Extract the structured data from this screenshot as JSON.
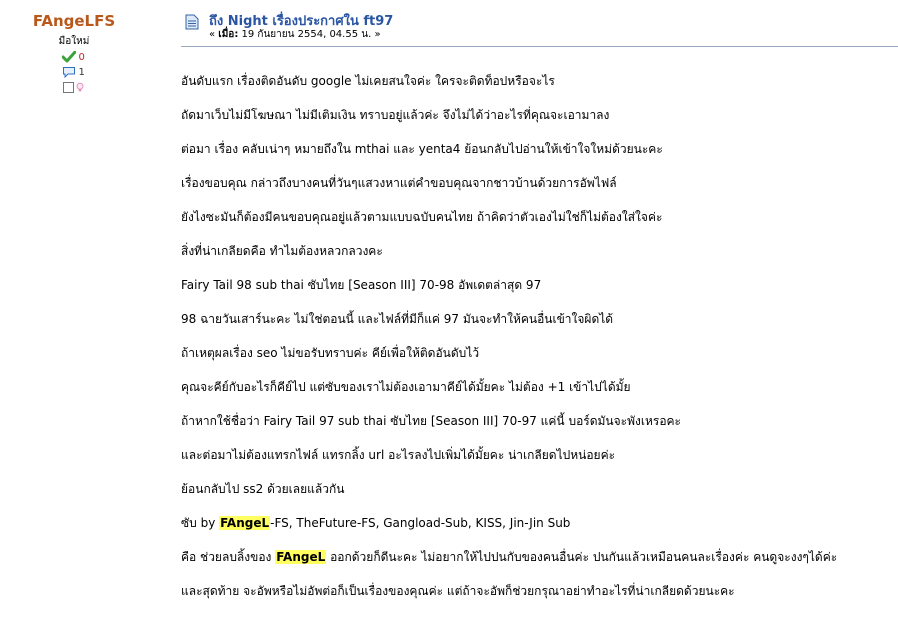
{
  "poster": {
    "name": "FAngeLFS",
    "rank": "มือใหม่",
    "karma_good": "0",
    "karma_comments": "1"
  },
  "post": {
    "subject": "ถึง Night เรื่องประกาศใน ft97",
    "meta_prefix": "« ",
    "meta_label": "เมื่อ:",
    "meta_date": " 19 กันยายน 2554, 04.55 น. »",
    "lines": [
      "อันดับแรก เรื่องติดอันดับ google ไม่เคยสนใจค่ะ ใครจะติดท็อปหรือจะไร",
      "ถัดมาเว็บไม่มีโฆษณา ไม่มีเติมเงิน ทราบอยู่แล้วค่ะ จึงไม่ได้ว่าอะไรที่คุณจะเอามาลง",
      "ต่อมา เรื่อง คลับเน่าๆ หมายถึงใน mthai และ yenta4 ย้อนกลับไปอ่านให้เข้าใจใหม่ด้วยนะคะ",
      "เรื่องขอบคุณ กล่าวถึงบางคนที่วันๆแสวงหาแต่คำขอบคุณจากชาวบ้านด้วยการอัพไฟล์",
      "ยังไงซะมันก็ต้องมีคนขอบคุณอยู่แล้วตามแบบฉบับคนไทย ถ้าคิดว่าตัวเองไม่ใช่ก็ไม่ต้องใส่ใจค่ะ",
      "สิ่งที่น่าเกลียดคือ ทำไมต้องหลวกลวงคะ",
      "Fairy Tail 98 sub thai ซับไทย [Season III] 70-98 อัพเดตล่าสุด 97",
      "98 ฉายวันเสาร์นะคะ ไม่ใช่ตอนนี้ และไฟล์ที่มีก็แค่ 97 มันจะทำให้คนอื่นเข้าใจผิดได้",
      "ถ้าเหตุผลเรื่อง seo ไม่ขอรับทราบค่ะ คีย์เพื่อให้ติดอันดับไว้",
      "คุณจะคีย์กับอะไรก็คีย์ไป แต่ซับของเราไม่ต้องเอามาคีย์ได้มั้ยคะ ไม่ต้อง +1 เข้าไปได้มั้ย",
      "ถ้าหากใช้ชื่อว่า Fairy Tail 97 sub thai ซับไทย [Season III] 70-97 แค่นี้ บอร์ดมันจะพังเหรอคะ",
      "และต่อมาไม่ต้องแทรกไฟล์ แทรกลิ้ง url อะไรลงไปเพิ่มได้มั้ยคะ น่าเกลียดไปหน่อยค่ะ",
      "ย้อนกลับไป ss2 ด้วยเลยแล้วกัน"
    ],
    "sub_line": {
      "prefix": "ซับ by ",
      "highlight": "FAngeL",
      "suffix": "-FS, TheFuture-FS, Gangload-Sub, KISS, Jin-Jin Sub"
    },
    "remove_line": {
      "prefix": "คือ ช่วยลบลิ้งของ ",
      "highlight": "FAngeL",
      "suffix": " ออกด้วยก็ดีนะคะ ไม่อยากให้ไปปนกับของคนอื่นค่ะ ปนกันแล้วเหมือนคนละเรื่องค่ะ คนดูจะงงๆได้ค่ะ"
    },
    "last_line": "และสุดท้าย จะอัพหรือไม่อัพต่อก็เป็นเรื่องของคุณค่ะ แต่ถ้าจะอัพก็ช่วยกรุณาอย่าทำอะไรที่น่าเกลียดด้วยนะคะ"
  },
  "colors": {
    "name": "#b8581a",
    "subject": "#2a55a3",
    "highlight": "#ffff60",
    "karma": "#c2272d"
  }
}
